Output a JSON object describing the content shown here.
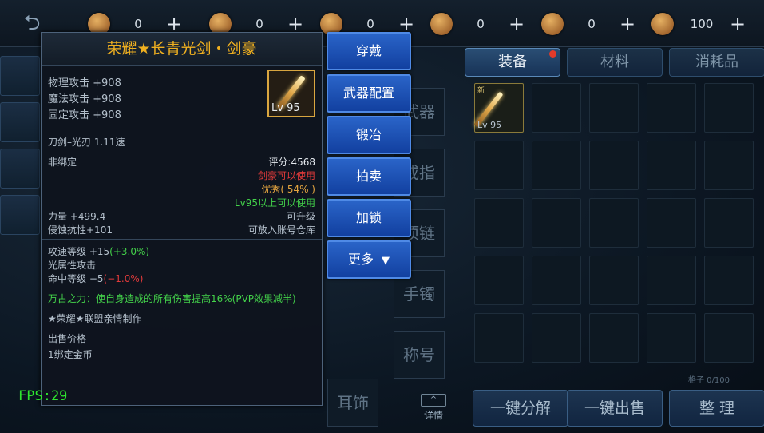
{
  "currencies": [
    {
      "icon": "ticket-icon",
      "value": "0"
    },
    {
      "icon": "gold-coin-icon",
      "value": "0"
    },
    {
      "icon": "scroll-icon",
      "value": "0"
    },
    {
      "icon": "gift-icon",
      "value": "0"
    },
    {
      "icon": "coin-bag-icon",
      "value": "0"
    },
    {
      "icon": "coin-stack-icon",
      "value": "100"
    }
  ],
  "plus_symbol": "+",
  "tabs": [
    {
      "label": "装备",
      "active": true
    },
    {
      "label": "材料",
      "active": false
    },
    {
      "label": "消耗品",
      "active": false
    }
  ],
  "equip_slots": [
    "武器",
    "戒指",
    "项链",
    "手镯",
    "称号",
    "耳饰"
  ],
  "inventory": {
    "first_item": {
      "tag": "新",
      "level": "Lv 95"
    },
    "capacity": "格子 0/100"
  },
  "bottom_buttons": [
    "一键分解",
    "一键出售",
    "整 理"
  ],
  "detail_label": "详情",
  "tooltip": {
    "title": "荣耀★长青光剑・剑豪",
    "stats": [
      "物理攻击 +908",
      "魔法攻击 +908",
      "固定攻击 +908"
    ],
    "icon_level": "Lv 95",
    "weapon_type": "刀剑–光刃   1.11速",
    "bind": "非绑定",
    "score": "评分:4568",
    "class_req": "剑豪可以使用",
    "quality": "优秀( 54% )",
    "level_req": "Lv95以上可以使用",
    "strength": "力量 +499.4",
    "upgradable": "可升级",
    "corrosion": "侵蚀抗性+101",
    "storable": "可放入账号仓库",
    "attack_speed": "攻速等级 +15",
    "attack_speed_pct": "(+3.0%)",
    "element": "光属性攻击",
    "hit_rate": "命中等级 −5",
    "hit_rate_pct": "(−1.0%)",
    "special": "万古之力：使自身造成的所有伤害提高16%(PVP效果减半)",
    "maker": "★荣耀★联盟亲情制作",
    "price_label": "出售价格",
    "price_value": "1绑定金币"
  },
  "actions": [
    "穿戴",
    "武器配置",
    "锻冶",
    "拍卖",
    "加锁",
    "更多"
  ],
  "fps": "FPS:29",
  "colors": {
    "title": "#f0b020",
    "red": "#e03a3a",
    "gold": "#e6a640",
    "green": "#43d24a",
    "button": "#1f55b8"
  }
}
